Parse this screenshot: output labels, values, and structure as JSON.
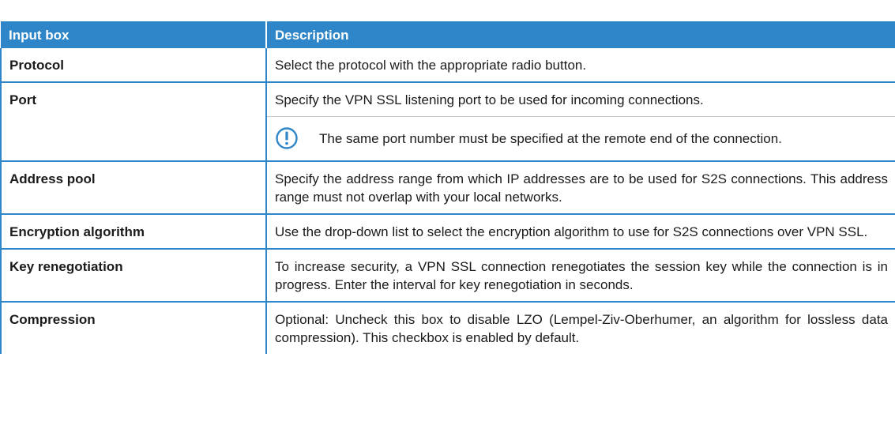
{
  "table": {
    "headers": [
      "Input box",
      "Description"
    ],
    "rows": [
      {
        "name": "Protocol",
        "description": "Select the protocol with the appropriate radio button."
      },
      {
        "name": "Port",
        "description": "Specify the VPN SSL listening port to be used for incoming connections.",
        "note": "The same port number must be specified at the remote end of the connection.",
        "note_icon": "exclamation-circle-icon"
      },
      {
        "name": "Address pool",
        "description": "Specify the address range from which IP addresses are to be used for S2S connections. This address range must not overlap with your local networks."
      },
      {
        "name": "Encryption algorithm",
        "description": "Use the drop-down list to select the encryption algorithm to use for S2S connections over VPN SSL."
      },
      {
        "name": "Key renegotiation",
        "description": "To increase security, a VPN SSL connection renegotiates the session key while the connection is in progress. Enter the interval for key renegotiation in seconds."
      },
      {
        "name": "Compression",
        "description": "Optional: Uncheck this box to disable LZO (Lempel-Ziv-Oberhumer, an algorithm for lossless data compression). This checkbox is enabled by default."
      }
    ]
  },
  "colors": {
    "header_bg": "#2e86c9",
    "border": "#2e86c9",
    "note_icon": "#2e86c9"
  }
}
